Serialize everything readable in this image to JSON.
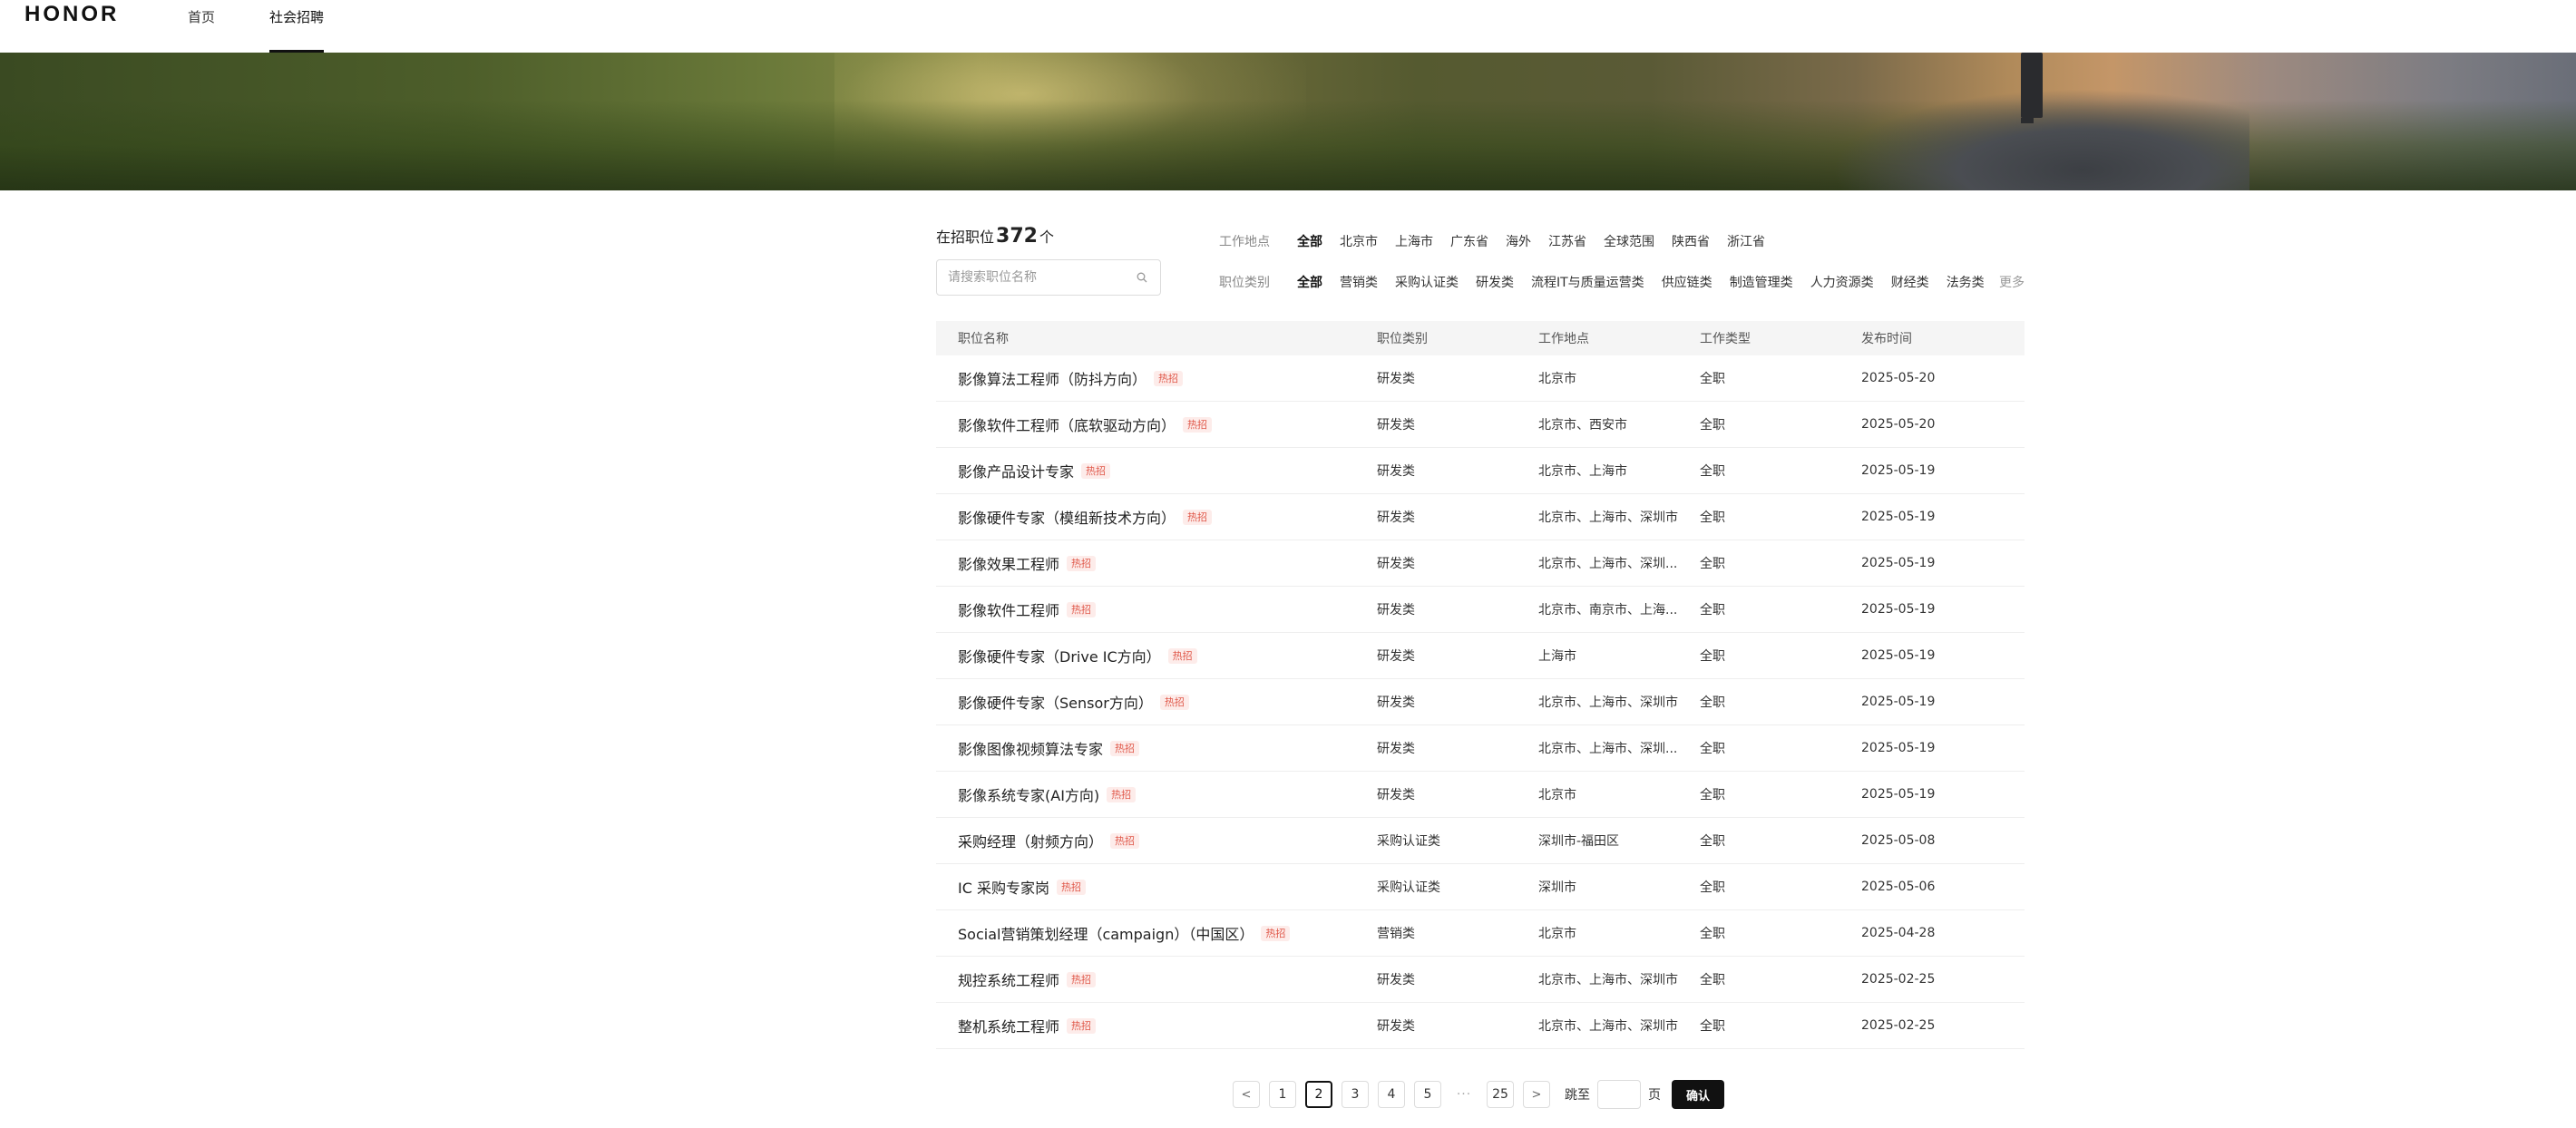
{
  "header": {
    "logo": "HONOR",
    "nav": [
      {
        "label": "首页"
      },
      {
        "label": "社会招聘"
      }
    ]
  },
  "summary": {
    "prefix": "在招职位",
    "count": "372",
    "suffix": "个"
  },
  "search": {
    "placeholder": "请搜索职位名称",
    "icon": "search-icon"
  },
  "filters": {
    "location": {
      "label": "工作地点",
      "options": [
        "全部",
        "北京市",
        "上海市",
        "广东省",
        "海外",
        "江苏省",
        "全球范围",
        "陕西省",
        "浙江省"
      ],
      "selected": "全部"
    },
    "category": {
      "label": "职位类别",
      "options": [
        "全部",
        "营销类",
        "采购认证类",
        "研发类",
        "流程IT与质量运营类",
        "供应链类",
        "制造管理类",
        "人力资源类",
        "财经类",
        "法务类"
      ],
      "selected": "全部",
      "more": "更多"
    }
  },
  "table": {
    "headers": [
      "职位名称",
      "职位类别",
      "工作地点",
      "工作类型",
      "发布时间"
    ],
    "hot_label": "热招",
    "rows": [
      {
        "title": "影像算法工程师（防抖方向）",
        "category": "研发类",
        "location": "北京市",
        "type": "全职",
        "date": "2025-05-20"
      },
      {
        "title": "影像软件工程师（底软驱动方向）",
        "category": "研发类",
        "location": "北京市、西安市",
        "type": "全职",
        "date": "2025-05-20"
      },
      {
        "title": "影像产品设计专家",
        "category": "研发类",
        "location": "北京市、上海市",
        "type": "全职",
        "date": "2025-05-19"
      },
      {
        "title": "影像硬件专家（模组新技术方向）",
        "category": "研发类",
        "location": "北京市、上海市、深圳市",
        "type": "全职",
        "date": "2025-05-19"
      },
      {
        "title": "影像效果工程师",
        "category": "研发类",
        "location": "北京市、上海市、深圳...",
        "type": "全职",
        "date": "2025-05-19"
      },
      {
        "title": "影像软件工程师",
        "category": "研发类",
        "location": "北京市、南京市、上海...",
        "type": "全职",
        "date": "2025-05-19"
      },
      {
        "title": "影像硬件专家（Drive IC方向）",
        "category": "研发类",
        "location": "上海市",
        "type": "全职",
        "date": "2025-05-19"
      },
      {
        "title": "影像硬件专家（Sensor方向）",
        "category": "研发类",
        "location": "北京市、上海市、深圳市",
        "type": "全职",
        "date": "2025-05-19"
      },
      {
        "title": "影像图像视频算法专家",
        "category": "研发类",
        "location": "北京市、上海市、深圳...",
        "type": "全职",
        "date": "2025-05-19"
      },
      {
        "title": "影像系统专家(AI方向)",
        "category": "研发类",
        "location": "北京市",
        "type": "全职",
        "date": "2025-05-19"
      },
      {
        "title": "采购经理（射频方向）",
        "category": "采购认证类",
        "location": "深圳市-福田区",
        "type": "全职",
        "date": "2025-05-08"
      },
      {
        "title": "IC 采购专家岗",
        "category": "采购认证类",
        "location": "深圳市",
        "type": "全职",
        "date": "2025-05-06"
      },
      {
        "title": "Social营销策划经理（campaign）（中国区）",
        "category": "营销类",
        "location": "北京市",
        "type": "全职",
        "date": "2025-04-28"
      },
      {
        "title": "规控系统工程师",
        "category": "研发类",
        "location": "北京市、上海市、深圳市",
        "type": "全职",
        "date": "2025-02-25"
      },
      {
        "title": "整机系统工程师",
        "category": "研发类",
        "location": "北京市、上海市、深圳市",
        "type": "全职",
        "date": "2025-02-25"
      }
    ]
  },
  "pagination": {
    "prev_icon": "chevron-left-icon",
    "next_icon": "chevron-right-icon",
    "pages": [
      "1",
      "2",
      "3",
      "4",
      "5"
    ],
    "current": "2",
    "ellipsis": "···",
    "last": "25",
    "jump_label": "跳至",
    "jump_value": "",
    "page_unit": "页",
    "confirm_label": "确认"
  }
}
